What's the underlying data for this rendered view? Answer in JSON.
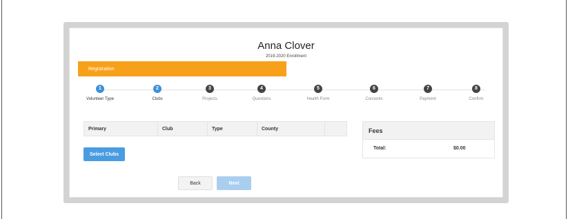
{
  "header": {
    "name": "Anna Clover",
    "enrollment": "2019-2020 Enrollment"
  },
  "registration_bar": {
    "label": "Registration",
    "color": "#f7a11a"
  },
  "steps": [
    {
      "number": "1",
      "label": "Volunteer Type",
      "state": "complete"
    },
    {
      "number": "2",
      "label": "Clubs",
      "state": "current"
    },
    {
      "number": "3",
      "label": "Projects",
      "state": "pending"
    },
    {
      "number": "4",
      "label": "Questions",
      "state": "pending"
    },
    {
      "number": "5",
      "label": "Health Form",
      "state": "pending"
    },
    {
      "number": "6",
      "label": "Consents",
      "state": "pending"
    },
    {
      "number": "7",
      "label": "Payment",
      "state": "pending"
    },
    {
      "number": "8",
      "label": "Confirm",
      "state": "pending"
    }
  ],
  "clubs_table": {
    "columns": [
      "Primary",
      "Club",
      "Type",
      "County",
      ""
    ]
  },
  "select_clubs_label": "Select Clubs",
  "fees": {
    "title": "Fees",
    "total_label": "Total:",
    "total_value": "$0.00"
  },
  "nav": {
    "back_label": "Back",
    "next_label": "Next"
  },
  "colors": {
    "accent_blue": "#3d8fd8",
    "inactive_step": "#444444",
    "next_disabled": "#a9cef0"
  }
}
